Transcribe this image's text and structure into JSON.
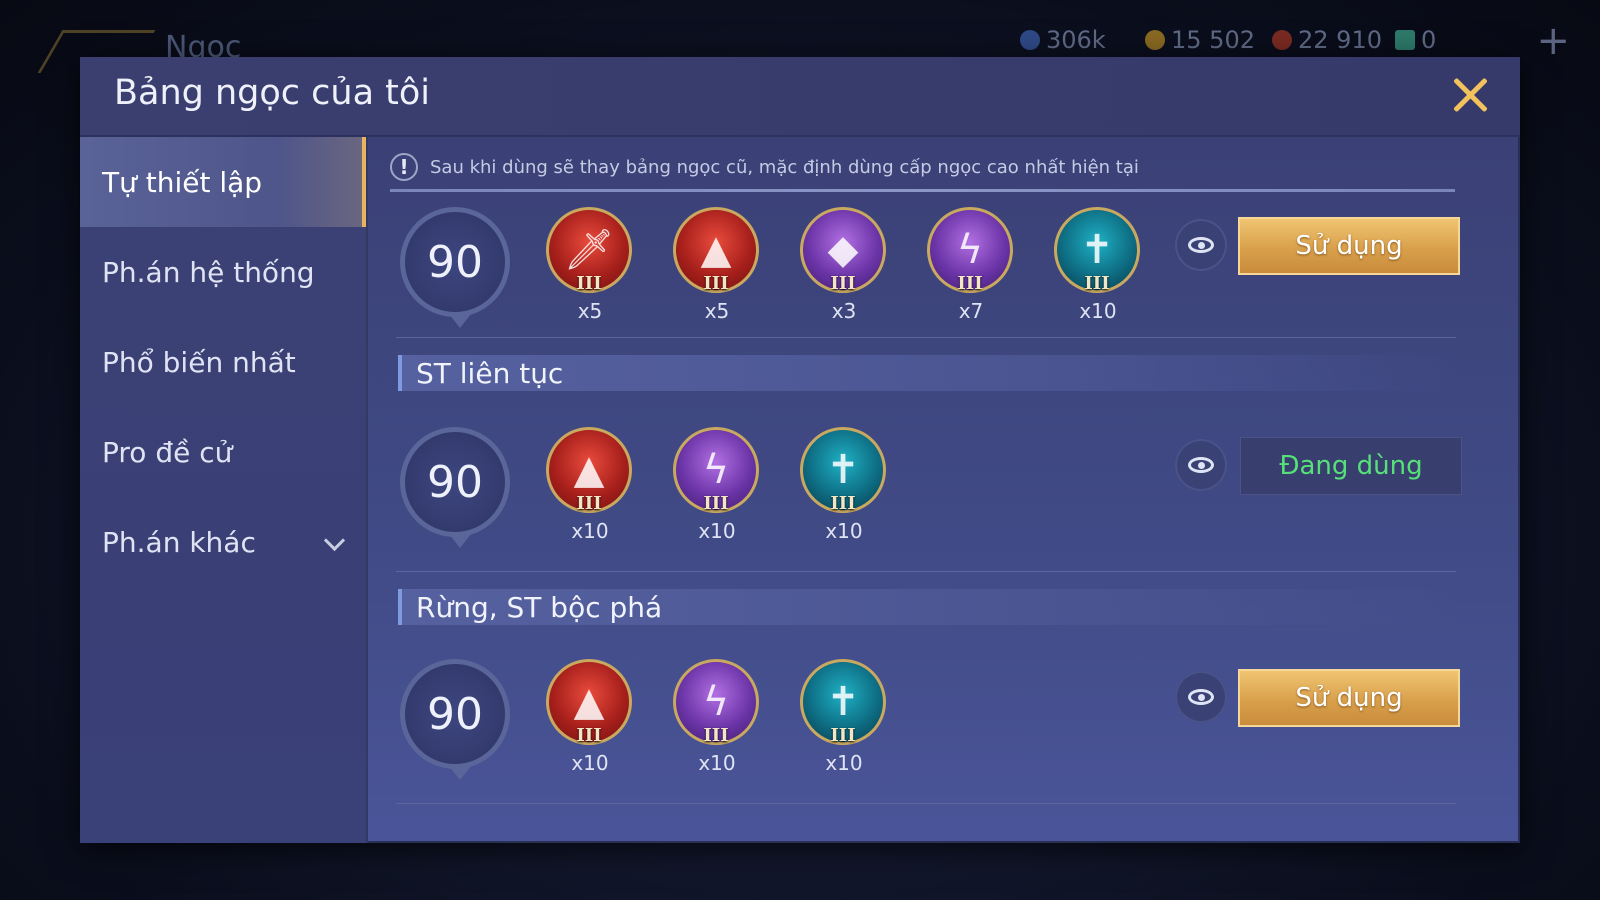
{
  "background": {
    "title": "Ngọc",
    "resources": [
      {
        "icon": "gem-currency-icon",
        "value": "306k"
      },
      {
        "icon": "gold-coin-icon",
        "value": "15 502"
      },
      {
        "icon": "red-crystal-icon",
        "value": "22 910"
      },
      {
        "icon": "voucher-icon",
        "value": "0"
      }
    ]
  },
  "modal": {
    "title": "Bảng ngọc của tôi"
  },
  "sidebar": {
    "items": [
      {
        "label": "Tự thiết lập"
      },
      {
        "label": "Ph.án hệ thống"
      },
      {
        "label": "Phổ biến nhất"
      },
      {
        "label": "Pro đề cử"
      },
      {
        "label": "Ph.án khác"
      }
    ]
  },
  "notice": "Sau khi dùng sẽ thay bảng ngọc cũ, mặc định dùng cấp ngọc cao nhất hiện tại",
  "pages": [
    {
      "section": "",
      "level": "90",
      "gems": [
        {
          "color": "red",
          "icon": "sword-gem-icon",
          "tier": "III",
          "count": "x5"
        },
        {
          "color": "red",
          "icon": "flame-gem-icon",
          "tier": "III",
          "count": "x5"
        },
        {
          "color": "purple",
          "icon": "drop-gem-icon",
          "tier": "III",
          "count": "x3"
        },
        {
          "color": "purple",
          "icon": "lightning-gem-icon",
          "tier": "III",
          "count": "x7"
        },
        {
          "color": "teal",
          "icon": "dagger-gem-icon",
          "tier": "III",
          "count": "x10"
        }
      ],
      "button": "Sử dụng",
      "in_use": false
    },
    {
      "section": "ST liên tục",
      "level": "90",
      "gems": [
        {
          "color": "red",
          "icon": "flame-gem-icon",
          "tier": "III",
          "count": "x10"
        },
        {
          "color": "purple",
          "icon": "lightning-gem-icon",
          "tier": "III",
          "count": "x10"
        },
        {
          "color": "teal",
          "icon": "dagger-gem-icon",
          "tier": "III",
          "count": "x10"
        }
      ],
      "button": "Đang dùng",
      "in_use": true
    },
    {
      "section": "Rừng, ST bộc phá",
      "level": "90",
      "gems": [
        {
          "color": "red",
          "icon": "flame-gem-icon",
          "tier": "III",
          "count": "x10"
        },
        {
          "color": "purple",
          "icon": "lightning-gem-icon",
          "tier": "III",
          "count": "x10"
        },
        {
          "color": "teal",
          "icon": "dagger-gem-icon",
          "tier": "III",
          "count": "x10"
        }
      ],
      "button": "Sử dụng",
      "in_use": false
    }
  ],
  "colors": {
    "accent_gold": "#f2c25d",
    "in_use_green": "#57e07a",
    "modal_bg": "#404a85"
  }
}
